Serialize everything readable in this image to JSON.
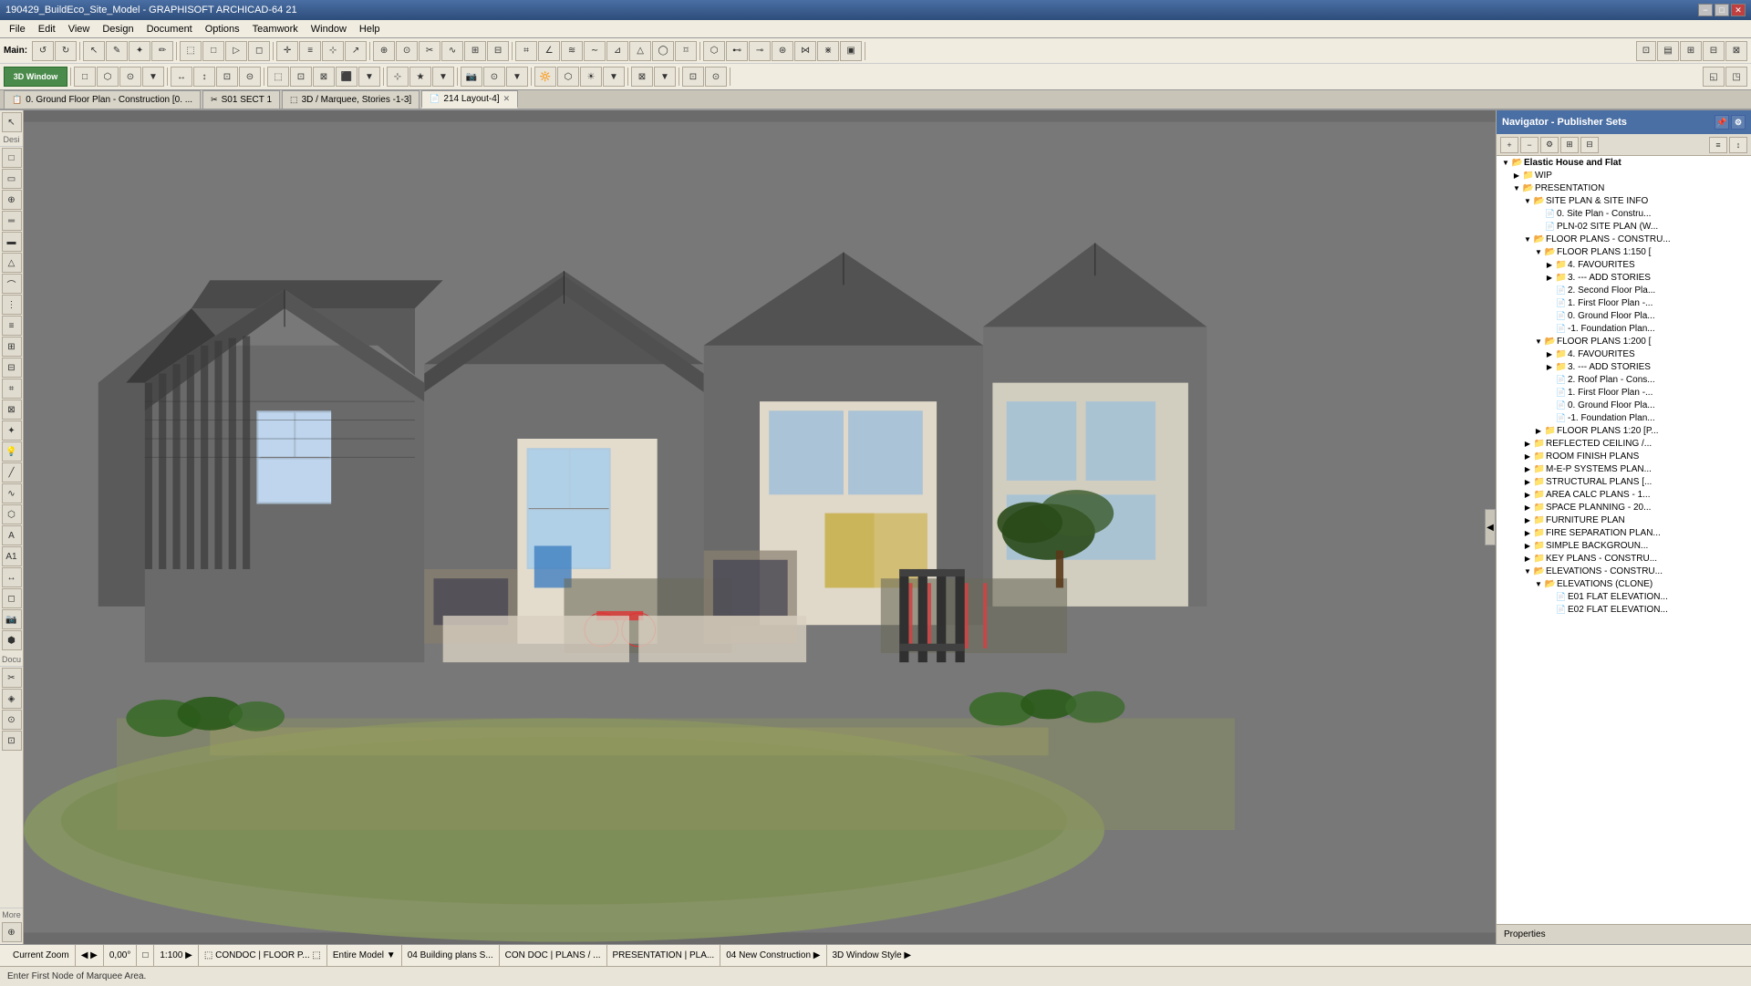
{
  "app": {
    "title": "190429_BuildEco_Site_Model - GRAPHISOFT ARCHICAD-64 21",
    "minimize": "−",
    "restore": "□",
    "close": "✕"
  },
  "menu": {
    "items": [
      "File",
      "Edit",
      "View",
      "Design",
      "Document",
      "Options",
      "Teamwork",
      "Window",
      "Help"
    ]
  },
  "tabs": [
    {
      "id": "ground-floor",
      "label": "0. Ground Floor Plan - Construction [0. ...",
      "icon": "📋",
      "active": false,
      "closeable": false
    },
    {
      "id": "s01-sect1",
      "label": "S01 SECT 1",
      "icon": "✂",
      "active": false,
      "closeable": false
    },
    {
      "id": "3d-marquee",
      "label": "3D / Marquee, Stories -1-3]",
      "icon": "🔲",
      "active": false,
      "closeable": false
    },
    {
      "id": "layout4",
      "label": "214 Layout-4]",
      "icon": "📄",
      "active": true,
      "closeable": true
    }
  ],
  "left_sidebar": {
    "sections": [
      {
        "label": "Desi",
        "tools": [
          "↖",
          "✦",
          "□",
          "◇",
          "⊙",
          "∠",
          "≡",
          "⊞",
          "⌗",
          "↗",
          "✏",
          "✂",
          "∿",
          "△",
          "A",
          "A1",
          "≈",
          "⊕",
          "○",
          "⊘"
        ]
      },
      {
        "label": "Docu",
        "tools": [
          "⊙",
          "✦",
          "✂",
          "A"
        ]
      },
      {
        "label": "More",
        "tools": [
          "↺",
          "🔍",
          "⊕",
          "⬚"
        ]
      }
    ]
  },
  "statusbar": {
    "segments": [
      {
        "label": "Current Zoom"
      },
      {
        "label": "◀  ▶"
      },
      {
        "label": "0,00°"
      },
      {
        "label": "□"
      },
      {
        "label": "1:100"
      },
      {
        "label": "▶"
      },
      {
        "label": "⬚  CONDOC | FLOOR P..."
      },
      {
        "label": "⬚"
      },
      {
        "label": "Entire Model"
      },
      {
        "label": "▼"
      },
      {
        "label": "04 Building plans S..."
      },
      {
        "label": "CON DOC | PLANS / ..."
      },
      {
        "label": "PRESENTATION | PLA..."
      },
      {
        "label": "04 New Construction ▶"
      },
      {
        "label": "3D Window Style ▶"
      }
    ]
  },
  "message": "Enter First Node of Marquee Area.",
  "right_panel": {
    "header": "Properties",
    "tree": [
      {
        "indent": 0,
        "type": "folder-open",
        "label": "Elastic House and Flat",
        "bold": true
      },
      {
        "indent": 1,
        "type": "folder",
        "label": "WIP"
      },
      {
        "indent": 1,
        "type": "folder-open",
        "label": "PRESENTATION"
      },
      {
        "indent": 2,
        "type": "folder-open",
        "label": "SITE PLAN & SITE INFO"
      },
      {
        "indent": 3,
        "type": "doc",
        "label": "0. Site Plan - Constru..."
      },
      {
        "indent": 3,
        "type": "doc",
        "label": "PLN-02 SITE PLAN (W..."
      },
      {
        "indent": 2,
        "type": "folder-open",
        "label": "FLOOR PLANS - CONSTRU..."
      },
      {
        "indent": 3,
        "type": "folder-open",
        "label": "FLOOR PLANS 1:150 ["
      },
      {
        "indent": 4,
        "type": "folder",
        "label": "4. FAVOURITES"
      },
      {
        "indent": 4,
        "type": "folder",
        "label": "3. --- ADD STORIES"
      },
      {
        "indent": 4,
        "type": "doc",
        "label": "2. Second Floor Pla..."
      },
      {
        "indent": 4,
        "type": "doc",
        "label": "1. First Floor Plan -..."
      },
      {
        "indent": 4,
        "type": "doc",
        "label": "0. Ground Floor Pla..."
      },
      {
        "indent": 4,
        "type": "doc",
        "label": "-1. Foundation Plan..."
      },
      {
        "indent": 3,
        "type": "folder-open",
        "label": "FLOOR PLANS 1:200 ["
      },
      {
        "indent": 4,
        "type": "folder",
        "label": "4. FAVOURITES"
      },
      {
        "indent": 4,
        "type": "folder",
        "label": "3. --- ADD STORIES"
      },
      {
        "indent": 4,
        "type": "doc",
        "label": "2. Roof Plan - Cons..."
      },
      {
        "indent": 4,
        "type": "doc",
        "label": "1. First Floor Plan -..."
      },
      {
        "indent": 4,
        "type": "doc",
        "label": "0. Ground Floor Pla..."
      },
      {
        "indent": 4,
        "type": "doc",
        "label": "-1. Foundation Plan..."
      },
      {
        "indent": 3,
        "type": "folder",
        "label": "FLOOR PLANS 1:20 [P..."
      },
      {
        "indent": 2,
        "type": "folder",
        "label": "REFLECTED CEILING /..."
      },
      {
        "indent": 2,
        "type": "folder",
        "label": "ROOM FINISH PLANS"
      },
      {
        "indent": 2,
        "type": "folder",
        "label": "M-E-P SYSTEMS PLAN..."
      },
      {
        "indent": 2,
        "type": "folder",
        "label": "STRUCTURAL PLANS [..."
      },
      {
        "indent": 2,
        "type": "folder",
        "label": "AREA CALC PLANS - 1..."
      },
      {
        "indent": 2,
        "type": "folder",
        "label": "SPACE PLANNING - 20..."
      },
      {
        "indent": 2,
        "type": "folder",
        "label": "FURNITURE PLAN"
      },
      {
        "indent": 2,
        "type": "folder",
        "label": "FIRE SEPARATION PLAN..."
      },
      {
        "indent": 2,
        "type": "folder",
        "label": "SIMPLE BACKGROUN..."
      },
      {
        "indent": 2,
        "type": "folder",
        "label": "KEY PLANS - CONSTRU..."
      },
      {
        "indent": 2,
        "type": "folder-open",
        "label": "ELEVATIONS - CONSTRU..."
      },
      {
        "indent": 3,
        "type": "folder-open",
        "label": "ELEVATIONS (CLONE)"
      },
      {
        "indent": 4,
        "type": "doc",
        "label": "E01 FLAT ELEVATION..."
      },
      {
        "indent": 4,
        "type": "doc",
        "label": "E02 FLAT ELEVATION..."
      }
    ]
  },
  "toolbar1_label": "Main:",
  "toolbar2_label": "3D Window",
  "icons": {
    "undo": "↺",
    "redo": "↻",
    "arrow": "↖",
    "marquee": "⬚",
    "folder": "📁",
    "doc": "📄",
    "folder_open": "📂",
    "triangle_right": "▶",
    "triangle_down": "▼",
    "triangle_right_small": "▸",
    "triangle_down_small": "▾"
  }
}
